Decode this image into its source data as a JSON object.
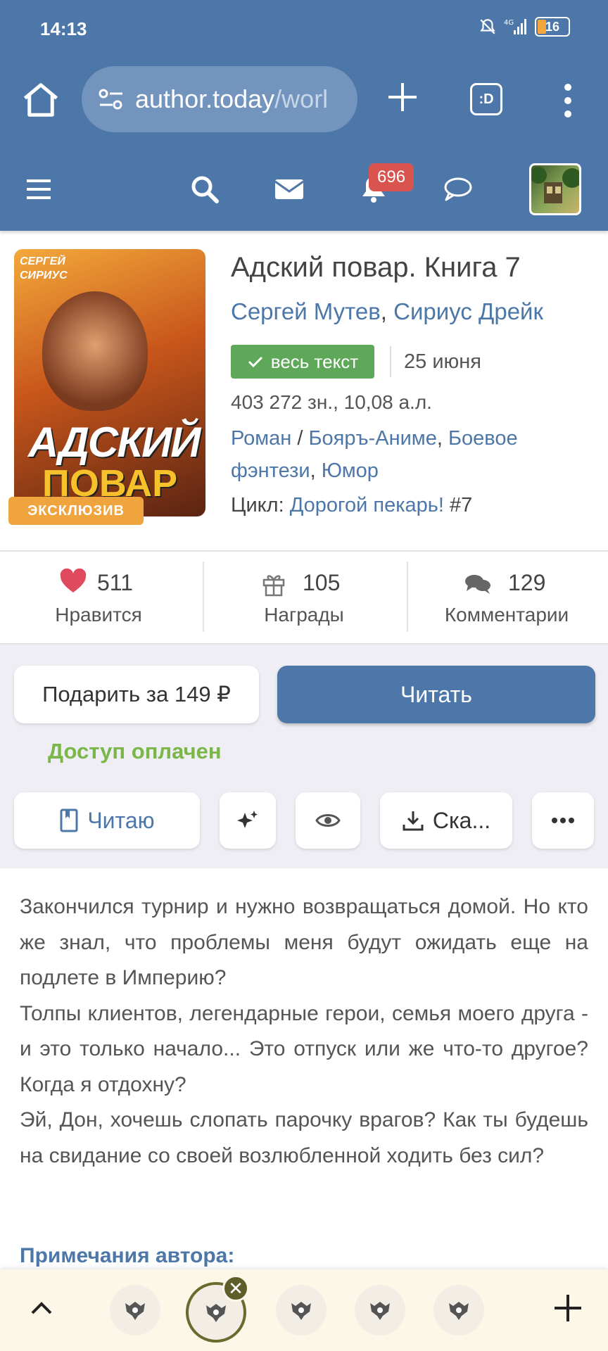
{
  "status": {
    "time": "14:13",
    "battery": "16",
    "network": "4G"
  },
  "browser": {
    "url_host": "author.today",
    "url_path": "/worl",
    "tabs_label": ":D"
  },
  "sitenav": {
    "notifications": "696"
  },
  "book": {
    "title": "Адский повар. Книга 7",
    "author1": "Сергей Мутев",
    "author_sep": ", ",
    "author2": "Сириус Дрейк",
    "status_badge": "весь текст",
    "date": "25 июня",
    "size": "403 272 зн., 10,08 а.л.",
    "genre1": "Роман",
    "genre_sep1": " / ",
    "genre2": "Бояръ-Аниме",
    "genre_sep2": ", ",
    "genre3": "Боевое фэнтези",
    "genre_sep3": ", ",
    "genre4": "Юмор",
    "cycle_label": "Цикл: ",
    "cycle_name": "Дорогой пекарь!",
    "cycle_num": " #7",
    "cover_title1": "АДСКИЙ",
    "cover_title2": "ПОВАР",
    "cover_authors": "СЕРГЕЙ\nСИРИУС",
    "exclusive": "ЭКСКЛЮЗИВ"
  },
  "stats": {
    "likes": "511",
    "likes_label": "Нравится",
    "awards": "105",
    "awards_label": "Награды",
    "comments": "129",
    "comments_label": "Комментарии"
  },
  "actions": {
    "gift": "Подарить за 149 ₽",
    "read": "Читать",
    "paid": "Доступ оплачен",
    "reading": "Читаю",
    "download": "Ска..."
  },
  "description": {
    "text": "Закончился турнир и нужно возвращаться домой. Но кто же знал, что проблемы меня будут ожидать еще на подлете в Империю?\nТолпы клиентов, легендарные герои, семья моего друга - и это только начало... Это отпуск или же что-то другое? Когда я отдохну?\nЭй, Дон, хочешь слопать парочку врагов? Как ты будешь на свидание со своей возлюбленной ходить без сил?",
    "notes_heading": "Примечания автора:"
  },
  "colors": {
    "brand": "#4d77a8",
    "success": "#5fa85a",
    "paid": "#7ab648",
    "like": "#e04a5f",
    "exclusive": "#f0a43e"
  }
}
